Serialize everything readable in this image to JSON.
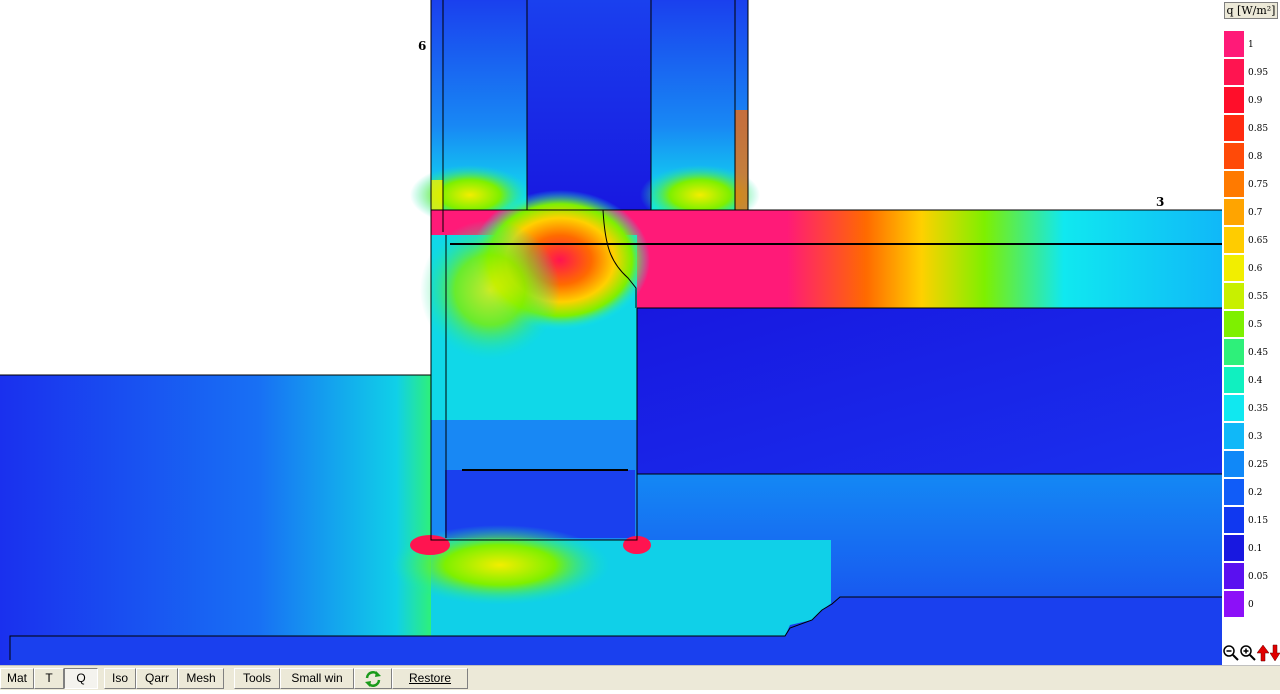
{
  "plot": {
    "node_labels": {
      "n6": "6",
      "n3": "3"
    }
  },
  "legend": {
    "unit": "q [W/m²]",
    "scale": [
      {
        "value": "1",
        "color": "#ff1a78"
      },
      {
        "value": "0.95",
        "color": "#ff1450"
      },
      {
        "value": "0.9",
        "color": "#ff0e2a"
      },
      {
        "value": "0.85",
        "color": "#ff2a10"
      },
      {
        "value": "0.8",
        "color": "#ff4a08"
      },
      {
        "value": "0.75",
        "color": "#ff7a00"
      },
      {
        "value": "0.7",
        "color": "#ffa400"
      },
      {
        "value": "0.65",
        "color": "#ffcc00"
      },
      {
        "value": "0.6",
        "color": "#f2ee00"
      },
      {
        "value": "0.55",
        "color": "#c8f000"
      },
      {
        "value": "0.5",
        "color": "#7ef000"
      },
      {
        "value": "0.45",
        "color": "#2ef07a"
      },
      {
        "value": "0.4",
        "color": "#10f0c0"
      },
      {
        "value": "0.35",
        "color": "#10e8f0"
      },
      {
        "value": "0.3",
        "color": "#10b8f8"
      },
      {
        "value": "0.25",
        "color": "#1088f8"
      },
      {
        "value": "0.2",
        "color": "#105cf8"
      },
      {
        "value": "0.15",
        "color": "#1038f0"
      },
      {
        "value": "0.1",
        "color": "#1818e0"
      },
      {
        "value": "0.05",
        "color": "#5a10f0"
      },
      {
        "value": "0",
        "color": "#8c10f8"
      }
    ]
  },
  "zoom_tools": [
    "zoom-out-icon",
    "zoom-in-icon",
    "arrow-up-icon",
    "arrow-down-icon"
  ],
  "toolbar": {
    "mat": "Mat",
    "t": "T",
    "q": "Q",
    "iso": "Iso",
    "qarr": "Qarr",
    "mesh": "Mesh",
    "tools": "Tools",
    "small_win": "Small win",
    "restore": "Restore"
  }
}
